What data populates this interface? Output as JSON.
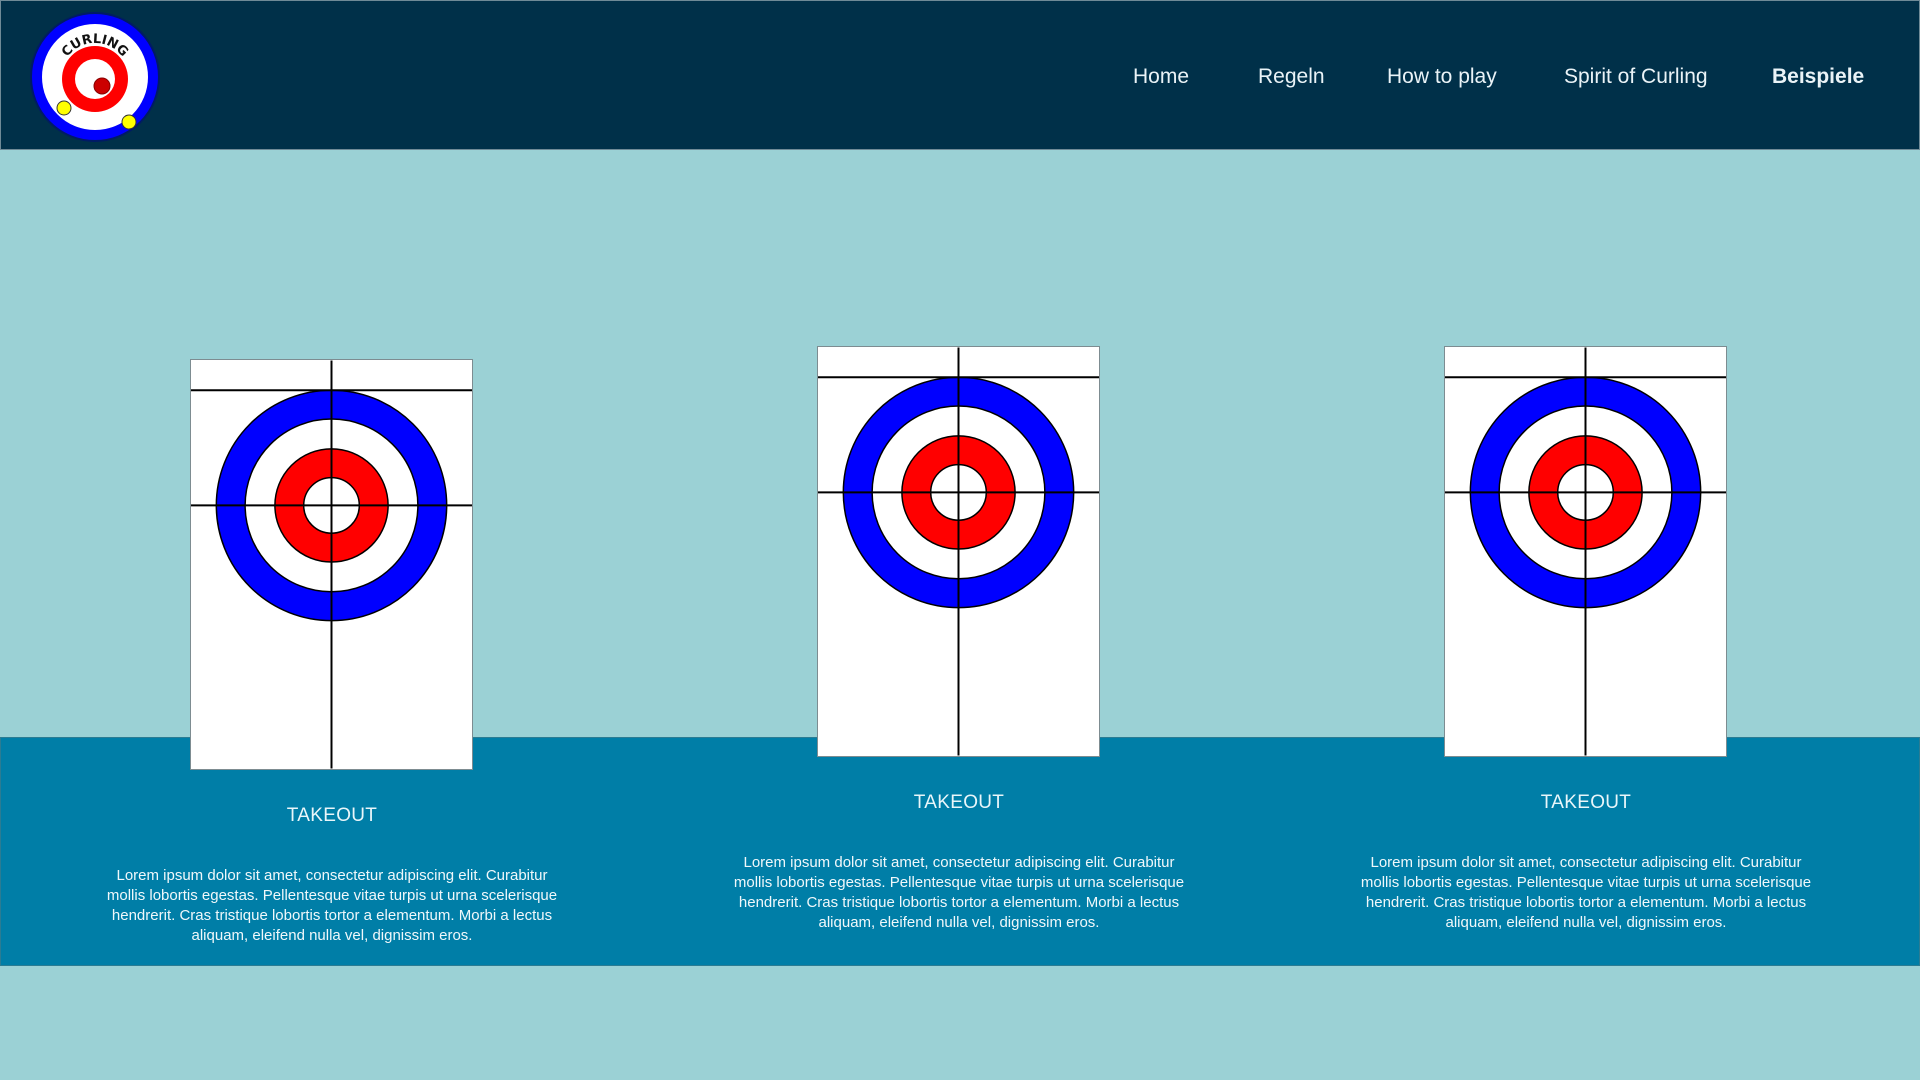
{
  "logo": {
    "text": "CURLING",
    "icon": "curling-house-logo"
  },
  "nav": {
    "items": [
      {
        "label": "Home"
      },
      {
        "label": "Regeln"
      },
      {
        "label": "How to play"
      },
      {
        "label": "Spirit of Curling"
      },
      {
        "label": "Beispiele",
        "active": true
      }
    ]
  },
  "cards": [
    {
      "title": "TAKEOUT",
      "text": "Lorem ipsum dolor sit amet, consectetur adipiscing elit. Curabitur mollis lobortis egestas. Pellentesque vitae turpis ut urna scelerisque hendrerit. Cras tristique lobortis tortor a elementum. Morbi a lectus aliquam, eleifend nulla vel, dignissim eros."
    },
    {
      "title": "TAKEOUT",
      "text": "Lorem ipsum dolor sit amet, consectetur adipiscing elit. Curabitur mollis lobortis egestas. Pellentesque vitae turpis ut urna scelerisque hendrerit. Cras tristique lobortis tortor a elementum. Morbi a lectus aliquam, eleifend nulla vel, dignissim eros."
    },
    {
      "title": "TAKEOUT",
      "text": "Lorem ipsum dolor sit amet, consectetur adipiscing elit. Curabitur mollis lobortis egestas. Pellentesque vitae turpis ut urna scelerisque hendrerit. Cras tristique lobortis tortor a elementum. Morbi a lectus aliquam, eleifend nulla vel, dignissim eros."
    }
  ],
  "colors": {
    "header_bg": "#003049",
    "page_bg": "#9bd1d5",
    "band_bg": "#007ea7",
    "ring_blue": "#0000ff",
    "ring_red": "#ff0000",
    "stone_yellow": "#ffff00"
  }
}
